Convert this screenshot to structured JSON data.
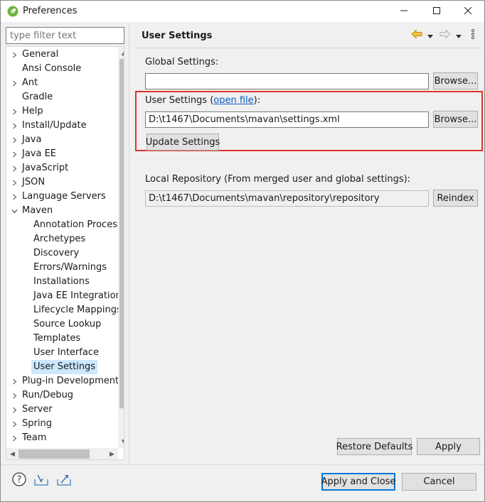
{
  "window": {
    "title": "Preferences",
    "app_icon": "spring-leaf-icon",
    "controls": [
      "minimize-icon",
      "maximize-icon",
      "close-icon"
    ]
  },
  "filter": {
    "placeholder": "type filter text",
    "value": ""
  },
  "tree": {
    "items": [
      {
        "label": "General",
        "level": 0,
        "expandable": true,
        "expanded": false
      },
      {
        "label": "Ansi Console",
        "level": 0,
        "expandable": false
      },
      {
        "label": "Ant",
        "level": 0,
        "expandable": true,
        "expanded": false
      },
      {
        "label": "Gradle",
        "level": 0,
        "expandable": false
      },
      {
        "label": "Help",
        "level": 0,
        "expandable": true,
        "expanded": false
      },
      {
        "label": "Install/Update",
        "level": 0,
        "expandable": true,
        "expanded": false
      },
      {
        "label": "Java",
        "level": 0,
        "expandable": true,
        "expanded": false
      },
      {
        "label": "Java EE",
        "level": 0,
        "expandable": true,
        "expanded": false
      },
      {
        "label": "JavaScript",
        "level": 0,
        "expandable": true,
        "expanded": false
      },
      {
        "label": "JSON",
        "level": 0,
        "expandable": true,
        "expanded": false
      },
      {
        "label": "Language Servers",
        "level": 0,
        "expandable": true,
        "expanded": false
      },
      {
        "label": "Maven",
        "level": 0,
        "expandable": true,
        "expanded": true
      },
      {
        "label": "Annotation Process",
        "level": 1,
        "expandable": false
      },
      {
        "label": "Archetypes",
        "level": 1,
        "expandable": false
      },
      {
        "label": "Discovery",
        "level": 1,
        "expandable": false
      },
      {
        "label": "Errors/Warnings",
        "level": 1,
        "expandable": false
      },
      {
        "label": "Installations",
        "level": 1,
        "expandable": false
      },
      {
        "label": "Java EE Integration",
        "level": 1,
        "expandable": false
      },
      {
        "label": "Lifecycle Mappings",
        "level": 1,
        "expandable": false
      },
      {
        "label": "Source Lookup",
        "level": 1,
        "expandable": false
      },
      {
        "label": "Templates",
        "level": 1,
        "expandable": false
      },
      {
        "label": "User Interface",
        "level": 1,
        "expandable": false
      },
      {
        "label": "User Settings",
        "level": 1,
        "expandable": false,
        "selected": true
      },
      {
        "label": "Plug-in Development",
        "level": 0,
        "expandable": true,
        "expanded": false
      },
      {
        "label": "Run/Debug",
        "level": 0,
        "expandable": true,
        "expanded": false
      },
      {
        "label": "Server",
        "level": 0,
        "expandable": true,
        "expanded": false
      },
      {
        "label": "Spring",
        "level": 0,
        "expandable": true,
        "expanded": false
      },
      {
        "label": "Team",
        "level": 0,
        "expandable": true,
        "expanded": false
      }
    ]
  },
  "page": {
    "title": "User Settings",
    "nav_icons": [
      "back-arrow-icon",
      "back-dropdown-icon",
      "forward-arrow-icon",
      "forward-dropdown-icon",
      "view-menu-icon"
    ]
  },
  "global_settings": {
    "label": "Global Settings:",
    "value": "",
    "browse_label": "Browse..."
  },
  "user_settings": {
    "label_prefix": "User Settings (",
    "link_text": "open file",
    "label_suffix": "):",
    "value": "D:\\t1467\\Documents\\mavan\\settings.xml",
    "browse_label": "Browse...",
    "update_label": "Update Settings"
  },
  "local_repository": {
    "label": "Local Repository (From merged user and global settings):",
    "value": "D:\\t1467\\Documents\\mavan\\repository\\repository",
    "reindex_label": "Reindex"
  },
  "page_buttons": {
    "restore_defaults": "Restore Defaults",
    "apply": "Apply"
  },
  "dialog_buttons": {
    "apply_and_close": "Apply and Close",
    "cancel": "Cancel"
  },
  "bottom_icons": [
    "help-icon",
    "import-icon",
    "export-icon"
  ],
  "colors": {
    "highlight": "#e0342b",
    "selection": "#cce8ff",
    "link": "#0b5cc0",
    "spring_green": "#6db33f"
  }
}
